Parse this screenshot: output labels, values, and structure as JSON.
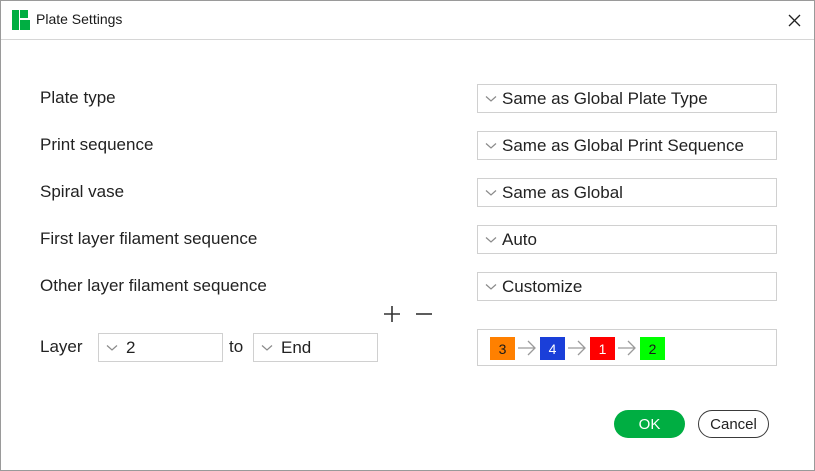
{
  "window": {
    "title": "Plate Settings"
  },
  "rows": {
    "plate_type": {
      "label": "Plate type",
      "value": "Same as Global Plate Type"
    },
    "print_sequence": {
      "label": "Print sequence",
      "value": "Same as Global Print Sequence"
    },
    "spiral_vase": {
      "label": "Spiral vase",
      "value": "Same as Global"
    },
    "first_layer": {
      "label": "First layer filament sequence",
      "value": "Auto"
    },
    "other_layer": {
      "label": "Other layer filament sequence",
      "value": "Customize"
    }
  },
  "layer_range": {
    "label": "Layer",
    "from_value": "2",
    "to_label": "to",
    "to_value": "End"
  },
  "filament_sequence": [
    {
      "number": "3",
      "color": "#ff8000"
    },
    {
      "number": "4",
      "color": "#1a3fd9"
    },
    {
      "number": "1",
      "color": "#ff0000"
    },
    {
      "number": "2",
      "color": "#00ff00"
    }
  ],
  "buttons": {
    "ok": "OK",
    "cancel": "Cancel"
  },
  "colors": {
    "accent_green": "#00ae42",
    "icon_green": "#00ae42"
  },
  "icons": {
    "app": "bambu-studio-icon",
    "close": "close-icon",
    "chevron": "chevron-down-icon",
    "add": "plus-icon",
    "remove": "minus-icon",
    "sequence_arrow": "arrow-right-icon"
  }
}
